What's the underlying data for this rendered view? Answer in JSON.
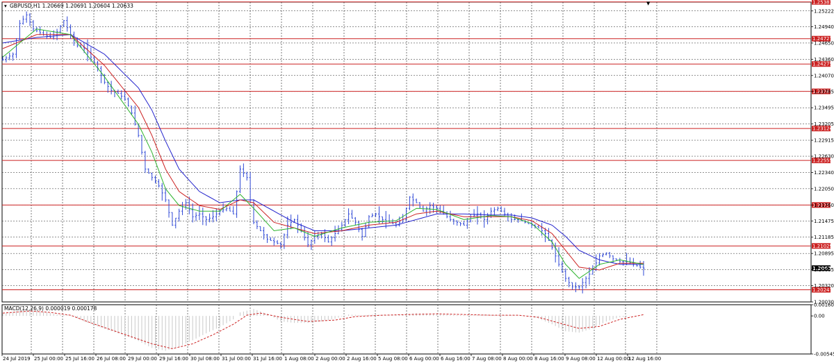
{
  "chart_data": {
    "type": "candlestick-line",
    "main_header": "GBPUSD,H1  1.20669 1.20691 1.20604 1.20633",
    "current_price": "1.20633",
    "y_range": [
      1.2003,
      1.2538
    ],
    "y_ticks": [
      "1.25222",
      "1.24940",
      "1.24650",
      "1.24360",
      "1.24070",
      "1.23785",
      "1.23495",
      "1.23205",
      "1.22915",
      "1.22630",
      "1.22340",
      "1.22050",
      "1.21760",
      "1.21475",
      "1.21185",
      "1.20895",
      "1.20605",
      "1.20320",
      "1.20030"
    ],
    "levels": [
      {
        "label": "1.25383",
        "value": 1.25383
      },
      {
        "label": "1.24727",
        "value": 1.24727
      },
      {
        "label": "1.24275",
        "value": 1.24275
      },
      {
        "label": "1.23787",
        "value": 1.23787
      },
      {
        "label": "1.23124",
        "value": 1.23124
      },
      {
        "label": "1.22555",
        "value": 1.22555
      },
      {
        "label": "1.21759",
        "value": 1.21759
      },
      {
        "label": "1.21029",
        "value": 1.21029
      },
      {
        "label": "1.20247",
        "value": 1.20247
      }
    ],
    "x_labels": [
      "24 Jul 2019",
      "25 Jul 00:00",
      "25 Jul 16:00",
      "26 Jul 08:00",
      "29 Jul 00:00",
      "29 Jul 16:00",
      "30 Jul 08:00",
      "31 Jul 00:00",
      "31 Jul 16:00",
      "1 Aug 08:00",
      "2 Aug 00:00",
      "2 Aug 16:00",
      "5 Aug 08:00",
      "6 Aug 00:00",
      "6 Aug 16:00",
      "7 Aug 08:00",
      "8 Aug 00:00",
      "8 Aug 16:00",
      "9 Aug 08:00",
      "12 Aug 00:00",
      "12 Aug 16:00"
    ],
    "price_path": [
      [
        0,
        1.2435
      ],
      [
        3,
        1.2445
      ],
      [
        5,
        1.25
      ],
      [
        7,
        1.2515
      ],
      [
        9,
        1.249
      ],
      [
        12,
        1.248
      ],
      [
        14,
        1.2475
      ],
      [
        16,
        1.2485
      ],
      [
        18,
        1.2505
      ],
      [
        20,
        1.248
      ],
      [
        22,
        1.246
      ],
      [
        24,
        1.2455
      ],
      [
        26,
        1.244
      ],
      [
        28,
        1.242
      ],
      [
        30,
        1.2395
      ],
      [
        32,
        1.238
      ],
      [
        34,
        1.2375
      ],
      [
        36,
        1.2365
      ],
      [
        38,
        1.234
      ],
      [
        40,
        1.23
      ],
      [
        42,
        1.224
      ],
      [
        44,
        1.2225
      ],
      [
        46,
        1.221
      ],
      [
        48,
        1.2185
      ],
      [
        50,
        1.214
      ],
      [
        52,
        1.2165
      ],
      [
        54,
        1.218
      ],
      [
        56,
        1.2155
      ],
      [
        58,
        1.216
      ],
      [
        60,
        1.215
      ],
      [
        62,
        1.2155
      ],
      [
        64,
        1.2165
      ],
      [
        66,
        1.217
      ],
      [
        68,
        1.216
      ],
      [
        70,
        1.224
      ],
      [
        72,
        1.2225
      ],
      [
        74,
        1.2145
      ],
      [
        76,
        1.213
      ],
      [
        78,
        1.2115
      ],
      [
        80,
        1.211
      ],
      [
        82,
        1.2105
      ],
      [
        84,
        1.214
      ],
      [
        86,
        1.215
      ],
      [
        88,
        1.213
      ],
      [
        90,
        1.2105
      ],
      [
        92,
        1.212
      ],
      [
        94,
        1.2125
      ],
      [
        96,
        1.211
      ],
      [
        98,
        1.2125
      ],
      [
        100,
        1.214
      ],
      [
        102,
        1.216
      ],
      [
        104,
        1.2145
      ],
      [
        106,
        1.212
      ],
      [
        108,
        1.2155
      ],
      [
        110,
        1.216
      ],
      [
        112,
        1.215
      ],
      [
        114,
        1.2145
      ],
      [
        116,
        1.214
      ],
      [
        118,
        1.215
      ],
      [
        120,
        1.219
      ],
      [
        122,
        1.218
      ],
      [
        124,
        1.2165
      ],
      [
        126,
        1.2175
      ],
      [
        128,
        1.217
      ],
      [
        130,
        1.216
      ],
      [
        132,
        1.215
      ],
      [
        134,
        1.2145
      ],
      [
        136,
        1.214
      ],
      [
        138,
        1.2155
      ],
      [
        140,
        1.216
      ],
      [
        142,
        1.215
      ],
      [
        144,
        1.2165
      ],
      [
        146,
        1.217
      ],
      [
        148,
        1.216
      ],
      [
        150,
        1.215
      ],
      [
        152,
        1.215
      ],
      [
        154,
        1.2145
      ],
      [
        156,
        1.214
      ],
      [
        158,
        1.2135
      ],
      [
        160,
        1.2125
      ],
      [
        162,
        1.21
      ],
      [
        164,
        1.207
      ],
      [
        166,
        1.2045
      ],
      [
        168,
        1.203
      ],
      [
        170,
        1.203
      ],
      [
        172,
        1.2045
      ],
      [
        174,
        1.206
      ],
      [
        176,
        1.2085
      ],
      [
        178,
        1.209
      ],
      [
        180,
        1.208
      ],
      [
        182,
        1.2075
      ],
      [
        184,
        1.2075
      ],
      [
        186,
        1.207
      ],
      [
        188,
        1.2065
      ],
      [
        189,
        1.20633
      ]
    ],
    "ma_fast_path": [
      [
        0,
        1.244
      ],
      [
        10,
        1.249
      ],
      [
        20,
        1.248
      ],
      [
        30,
        1.2405
      ],
      [
        40,
        1.232
      ],
      [
        44,
        1.227
      ],
      [
        48,
        1.2205
      ],
      [
        52,
        1.2175
      ],
      [
        58,
        1.2165
      ],
      [
        64,
        1.2165
      ],
      [
        70,
        1.2195
      ],
      [
        74,
        1.217
      ],
      [
        80,
        1.213
      ],
      [
        86,
        1.2135
      ],
      [
        92,
        1.212
      ],
      [
        100,
        1.2135
      ],
      [
        108,
        1.2145
      ],
      [
        116,
        1.2148
      ],
      [
        122,
        1.217
      ],
      [
        128,
        1.2168
      ],
      [
        136,
        1.215
      ],
      [
        144,
        1.2157
      ],
      [
        150,
        1.2155
      ],
      [
        156,
        1.2143
      ],
      [
        162,
        1.211
      ],
      [
        166,
        1.207
      ],
      [
        170,
        1.2045
      ],
      [
        176,
        1.207
      ],
      [
        182,
        1.2078
      ],
      [
        189,
        1.207
      ]
    ],
    "ma_mid_path": [
      [
        0,
        1.2455
      ],
      [
        10,
        1.248
      ],
      [
        20,
        1.248
      ],
      [
        30,
        1.2425
      ],
      [
        40,
        1.235
      ],
      [
        44,
        1.23
      ],
      [
        48,
        1.224
      ],
      [
        52,
        1.22
      ],
      [
        58,
        1.2175
      ],
      [
        64,
        1.2168
      ],
      [
        70,
        1.2185
      ],
      [
        74,
        1.218
      ],
      [
        80,
        1.2145
      ],
      [
        86,
        1.2135
      ],
      [
        92,
        1.2125
      ],
      [
        100,
        1.213
      ],
      [
        108,
        1.214
      ],
      [
        116,
        1.2145
      ],
      [
        122,
        1.216
      ],
      [
        128,
        1.2165
      ],
      [
        136,
        1.2155
      ],
      [
        144,
        1.2155
      ],
      [
        150,
        1.2155
      ],
      [
        156,
        1.2148
      ],
      [
        162,
        1.2125
      ],
      [
        166,
        1.2095
      ],
      [
        170,
        1.2065
      ],
      [
        176,
        1.206
      ],
      [
        182,
        1.2072
      ],
      [
        189,
        1.2072
      ]
    ],
    "ma_slow_path": [
      [
        0,
        1.2465
      ],
      [
        10,
        1.2475
      ],
      [
        20,
        1.248
      ],
      [
        30,
        1.2445
      ],
      [
        40,
        1.2385
      ],
      [
        44,
        1.2345
      ],
      [
        48,
        1.229
      ],
      [
        52,
        1.224
      ],
      [
        58,
        1.22
      ],
      [
        64,
        1.218
      ],
      [
        70,
        1.2185
      ],
      [
        74,
        1.2185
      ],
      [
        80,
        1.2165
      ],
      [
        86,
        1.2145
      ],
      [
        92,
        1.213
      ],
      [
        100,
        1.213
      ],
      [
        108,
        1.2135
      ],
      [
        116,
        1.214
      ],
      [
        122,
        1.215
      ],
      [
        128,
        1.216
      ],
      [
        136,
        1.216
      ],
      [
        144,
        1.2158
      ],
      [
        150,
        1.2158
      ],
      [
        156,
        1.2153
      ],
      [
        162,
        1.214
      ],
      [
        166,
        1.212
      ],
      [
        170,
        1.2095
      ],
      [
        176,
        1.2078
      ],
      [
        182,
        1.207
      ],
      [
        189,
        1.207
      ]
    ],
    "macd": {
      "header": "MACD(12,26,9) 0.000019 0.000178",
      "y_range": [
        -0.005458,
        0.001606
      ],
      "y_ticks": [
        "0.001606",
        "0.00",
        "-0.005458"
      ],
      "hist": [
        [
          0,
          0.0003
        ],
        [
          6,
          0.0009
        ],
        [
          12,
          0.0006
        ],
        [
          16,
          0.0002
        ],
        [
          20,
          0.0001
        ],
        [
          24,
          -0.0008
        ],
        [
          28,
          -0.0015
        ],
        [
          32,
          -0.0022
        ],
        [
          36,
          -0.0028
        ],
        [
          40,
          -0.0036
        ],
        [
          44,
          -0.0046
        ],
        [
          48,
          -0.005
        ],
        [
          52,
          -0.0044
        ],
        [
          56,
          -0.0035
        ],
        [
          60,
          -0.0025
        ],
        [
          64,
          -0.0016
        ],
        [
          68,
          -0.0005
        ],
        [
          70,
          0.0005
        ],
        [
          74,
          0.001
        ],
        [
          78,
          0.0003
        ],
        [
          82,
          -0.0008
        ],
        [
          86,
          -0.001
        ],
        [
          90,
          -0.001
        ],
        [
          94,
          -0.0008
        ],
        [
          98,
          -0.0004
        ],
        [
          102,
          0.0002
        ],
        [
          106,
          0.0001
        ],
        [
          110,
          0.0002
        ],
        [
          114,
          0.0001
        ],
        [
          118,
          0.0002
        ],
        [
          122,
          0.0004
        ],
        [
          126,
          0.0003
        ],
        [
          130,
          0.0002
        ],
        [
          134,
          0.0001
        ],
        [
          138,
          0.0001
        ],
        [
          142,
          0.0002
        ],
        [
          146,
          0.0001
        ],
        [
          150,
          0.0001
        ],
        [
          154,
          0.0
        ],
        [
          158,
          -0.0004
        ],
        [
          162,
          -0.0012
        ],
        [
          166,
          -0.0022
        ],
        [
          170,
          -0.0024
        ],
        [
          174,
          -0.0018
        ],
        [
          178,
          -0.0008
        ],
        [
          182,
          -0.0002
        ],
        [
          186,
          0.0
        ],
        [
          189,
          2e-05
        ]
      ],
      "signal": [
        [
          0,
          0.0004
        ],
        [
          8,
          0.0007
        ],
        [
          14,
          0.0005
        ],
        [
          20,
          0.0001
        ],
        [
          26,
          -0.001
        ],
        [
          32,
          -0.002
        ],
        [
          38,
          -0.003
        ],
        [
          44,
          -0.004
        ],
        [
          50,
          -0.0047
        ],
        [
          56,
          -0.004
        ],
        [
          62,
          -0.0027
        ],
        [
          68,
          -0.0012
        ],
        [
          72,
          0.0001
        ],
        [
          76,
          0.0004
        ],
        [
          82,
          -0.0002
        ],
        [
          90,
          -0.0008
        ],
        [
          98,
          -0.0006
        ],
        [
          104,
          -0.0001
        ],
        [
          112,
          0.0001
        ],
        [
          120,
          0.0002
        ],
        [
          128,
          0.0003
        ],
        [
          136,
          0.0002
        ],
        [
          144,
          0.0001
        ],
        [
          152,
          0.0001
        ],
        [
          158,
          -0.0002
        ],
        [
          164,
          -0.001
        ],
        [
          170,
          -0.0018
        ],
        [
          176,
          -0.0015
        ],
        [
          182,
          -0.0005
        ],
        [
          189,
          0.00018
        ]
      ]
    }
  },
  "colors": {
    "candle": "#2f48d6",
    "ma_fast": "#2db32d",
    "ma_mid": "#cc2222",
    "ma_slow": "#2222cc",
    "level": "#cc2222",
    "grid": "#222222",
    "macd_hist": "#c8c8c8",
    "macd_signal": "#cc2222"
  }
}
